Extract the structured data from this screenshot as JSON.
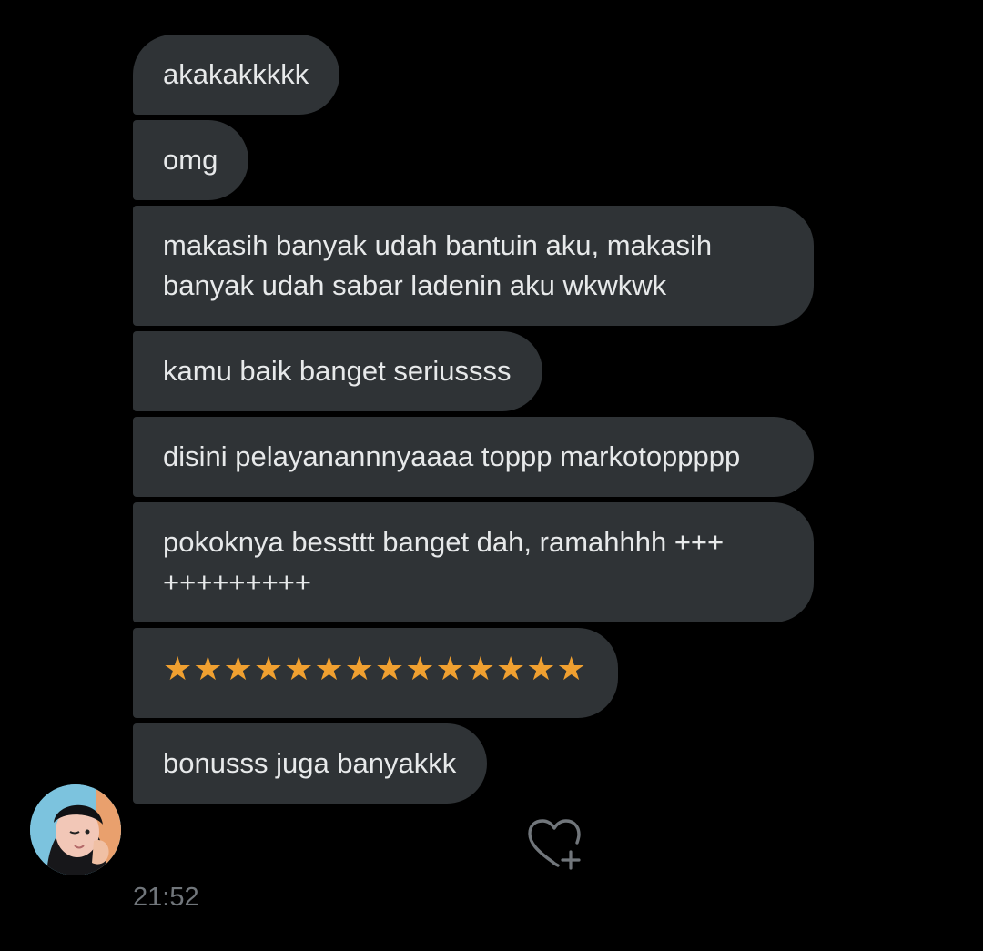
{
  "messages": [
    {
      "text": "akakakkkkk"
    },
    {
      "text": "omg"
    },
    {
      "text": "makasih banyak udah bantuin aku, makasih banyak udah sabar ladenin aku wkwkwk"
    },
    {
      "text": "kamu baik banget seriussss"
    },
    {
      "text": "disini pelayanannnyaaaa toppp markotoppppp"
    },
    {
      "text": "pokoknya bessttt banget dah, ramahhhh +++ +++++++++"
    },
    {
      "text": "★★★★★★★★★★★★★★"
    },
    {
      "text": "bonusss juga banyakkk"
    }
  ],
  "timestamp": "21:52",
  "icons": {
    "avatar": "user-avatar",
    "like": "heart-plus-icon"
  },
  "colors": {
    "background": "#000000",
    "bubble": "#2f3336",
    "text": "#e7e9ea",
    "star": "#f0a030",
    "muted": "#71767b"
  }
}
